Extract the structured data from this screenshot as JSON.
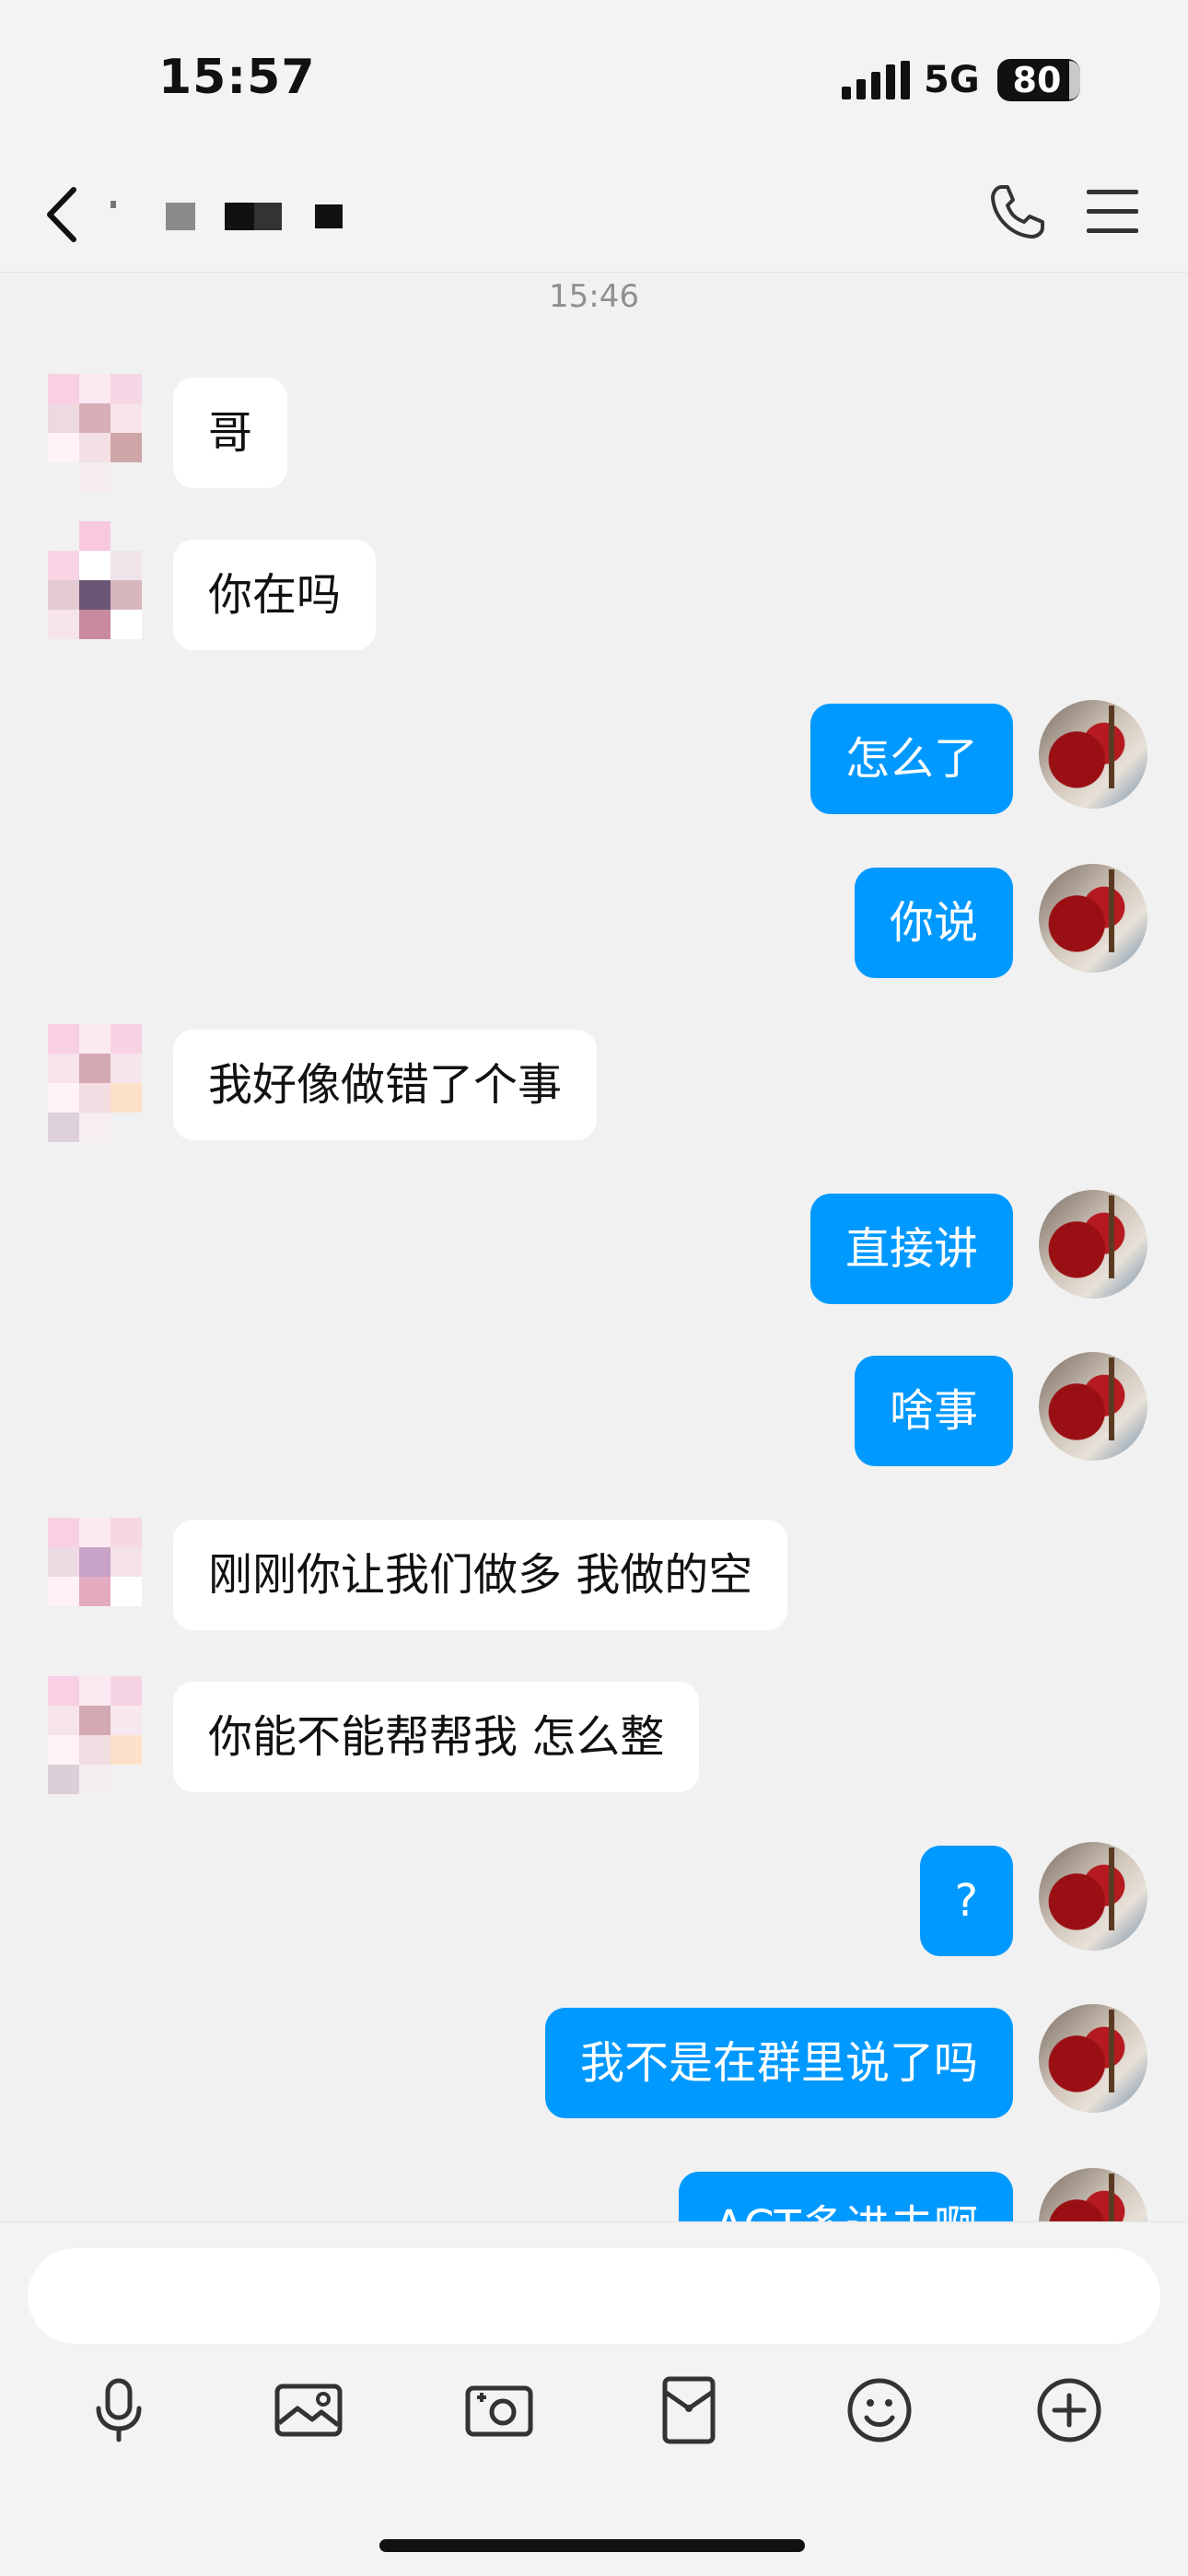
{
  "status_bar": {
    "time": "15:57",
    "network": "5G",
    "battery": "80"
  },
  "nav": {
    "contact_name_redacted": true
  },
  "conversation": {
    "timestamp": "15:46",
    "messages": [
      {
        "side": "in",
        "text": "哥"
      },
      {
        "side": "in",
        "text": "你在吗"
      },
      {
        "side": "out",
        "text": "怎么了"
      },
      {
        "side": "out",
        "text": "你说"
      },
      {
        "side": "in",
        "text": "我好像做错了个事"
      },
      {
        "side": "out",
        "text": "直接讲"
      },
      {
        "side": "out",
        "text": "啥事"
      },
      {
        "side": "in",
        "text": "刚刚你让我们做多 我做的空"
      },
      {
        "side": "in",
        "text": "你能不能帮帮我 怎么整"
      },
      {
        "side": "out",
        "text": "?"
      },
      {
        "side": "out",
        "text": "我不是在群里说了吗"
      },
      {
        "side": "out",
        "text": "ACT多进去啊"
      }
    ]
  },
  "colors": {
    "accent_blue": "#0099ff",
    "background": "#f1f1f1",
    "incoming_bubble": "#ffffff"
  },
  "toolbar": {
    "icons": [
      "microphone-icon",
      "image-icon",
      "camera-icon",
      "red-packet-icon",
      "emoji-icon",
      "plus-icon"
    ]
  }
}
